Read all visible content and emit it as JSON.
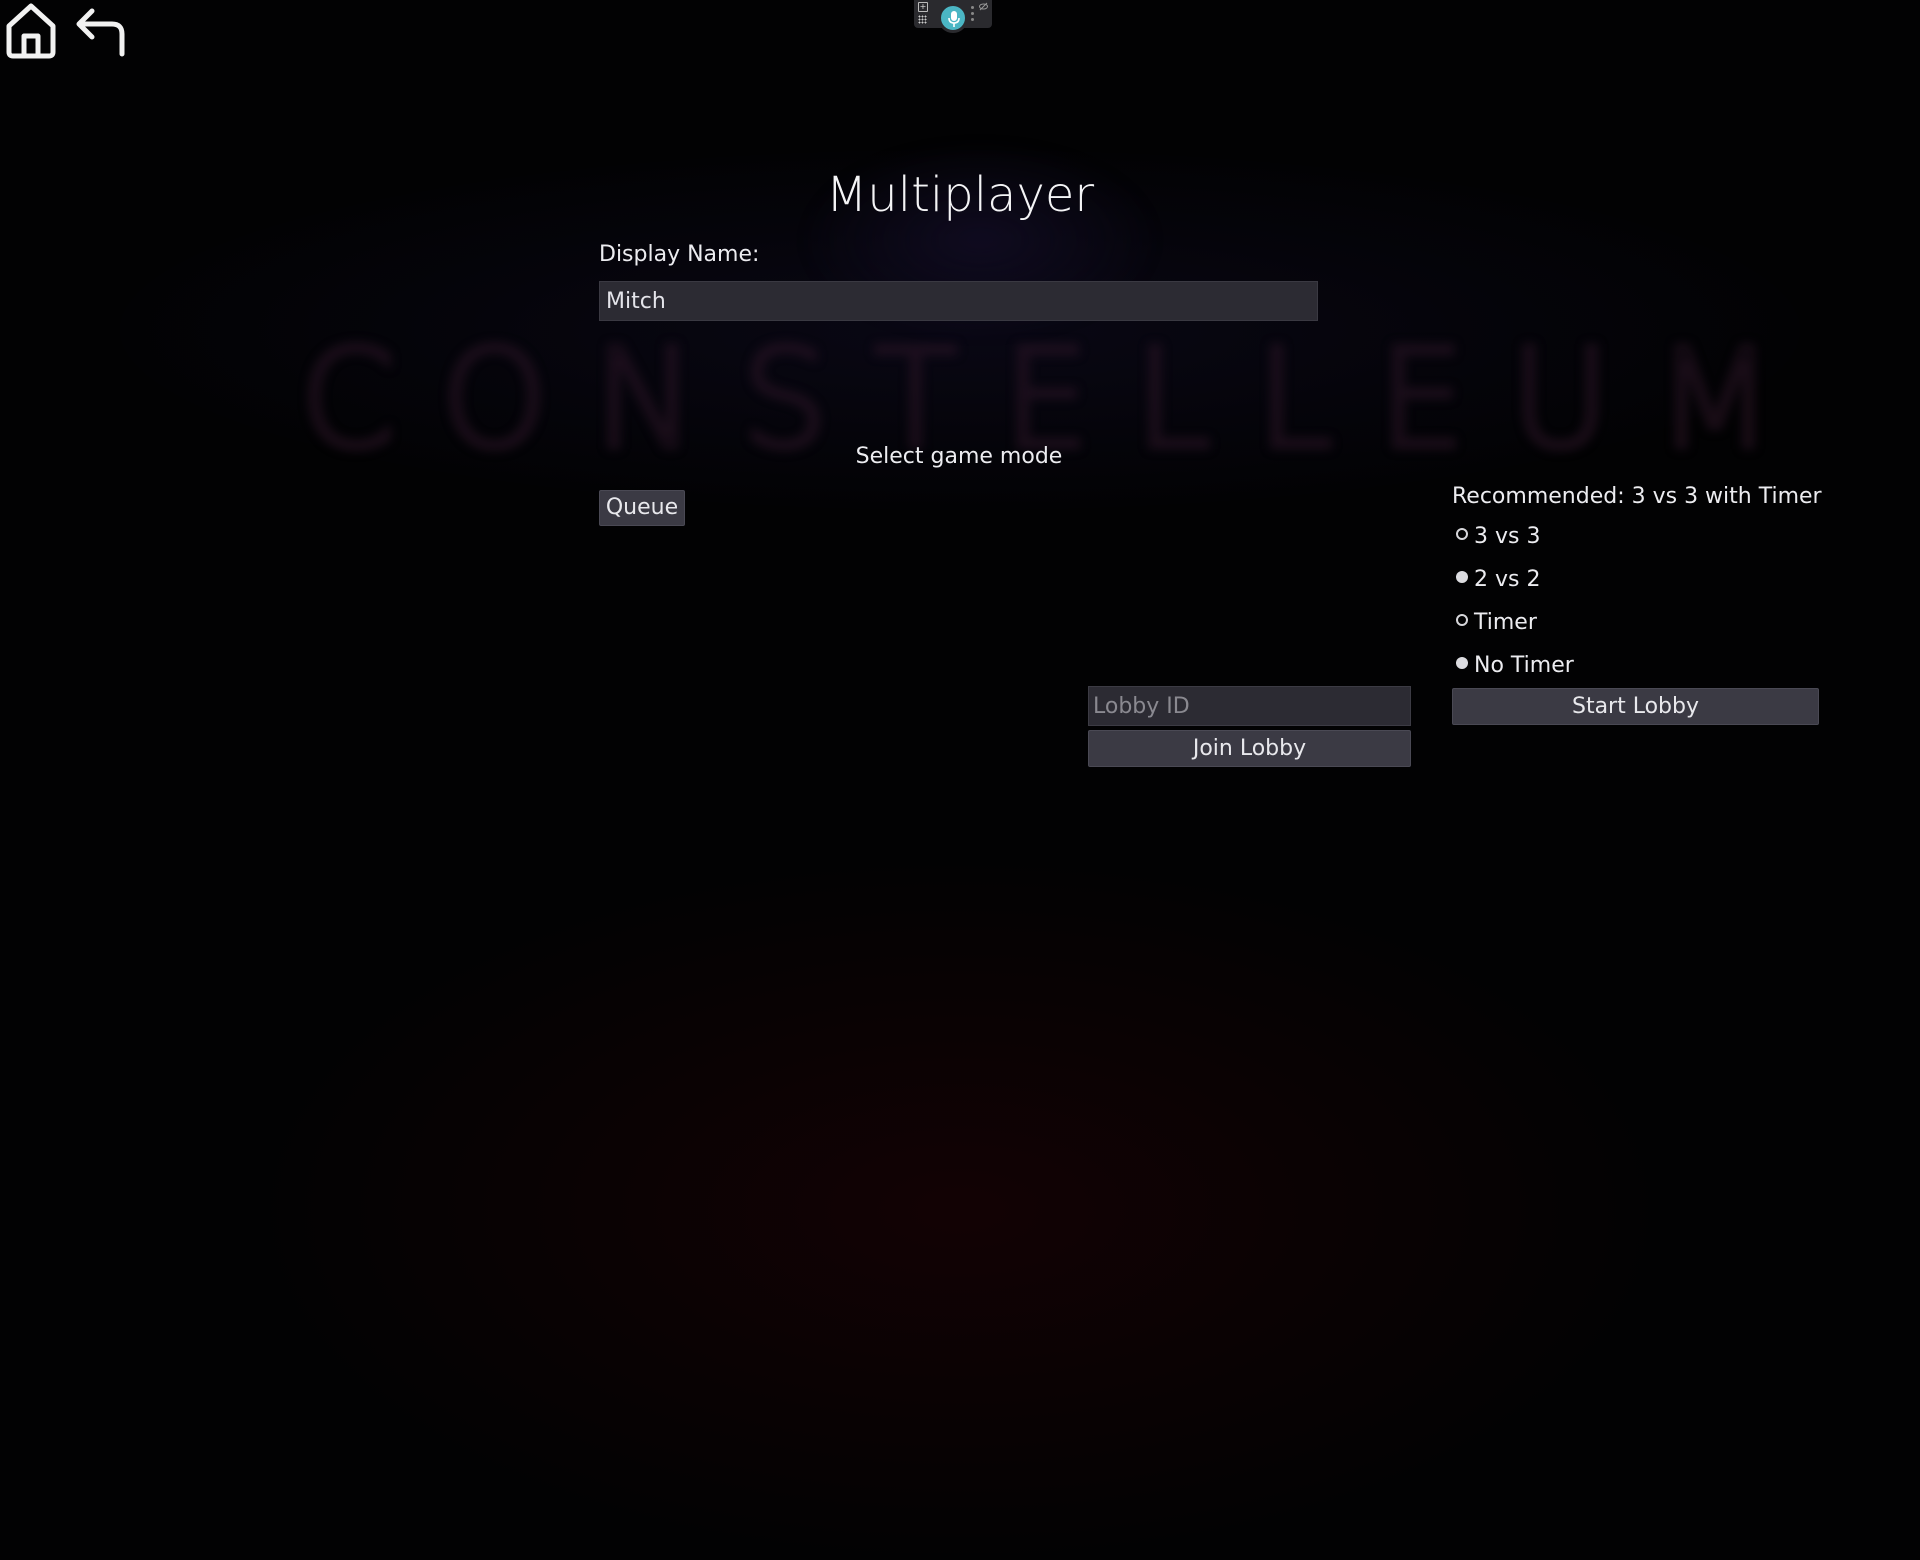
{
  "background": {
    "wordmark": "CONSTELLEUM",
    "base_color": "#020203",
    "accent_glow": "#180204"
  },
  "nav": {
    "home_icon": "home-icon",
    "back_icon": "back-arrow-icon"
  },
  "voice_widget": {
    "add_icon": "plus-icon",
    "grid_icon": "grid-icon",
    "mic_icon": "microphone-icon",
    "mic_color": "#4bb6c4",
    "hide_icon": "eye-off-icon"
  },
  "page": {
    "title": "Multiplayer",
    "display_name_label": "Display Name:",
    "display_name_value": "Mitch",
    "select_mode_label": "Select game mode",
    "queue_button": "Queue",
    "recommended_text": "Recommended: 3 vs 3 with Timer"
  },
  "modes": {
    "team_size": [
      {
        "label": "3 vs 3",
        "selected": true
      },
      {
        "label": "2 vs 2",
        "selected": false
      }
    ],
    "timer": [
      {
        "label": "Timer",
        "selected": true
      },
      {
        "label": "No Timer",
        "selected": false
      }
    ]
  },
  "lobby": {
    "lobby_id_placeholder": "Lobby ID",
    "lobby_id_value": "",
    "join_button": "Join Lobby",
    "start_button": "Start Lobby"
  }
}
